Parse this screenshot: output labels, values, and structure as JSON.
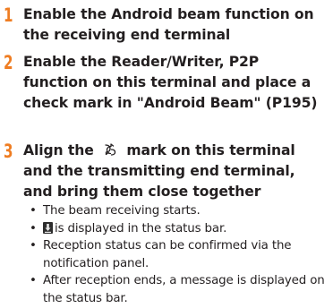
{
  "accent_color": "#ef7d22",
  "text_color": "#231f20",
  "steps": [
    {
      "number": "1",
      "text": "Enable the Android beam function on the receiving end terminal"
    },
    {
      "number": "2",
      "text": "Enable the Reader/Writer, P2P function on this terminal and place a check mark in \"Android Beam\" (P195)"
    },
    {
      "number": "3",
      "text_before": "Align the",
      "icon": "nfc-mark-icon",
      "text_after": "mark on this terminal and the transmitting end terminal, and bring them close together"
    }
  ],
  "bullets": [
    {
      "text": "The beam receiving starts."
    },
    {
      "icon": "download-status-icon",
      "text": "is displayed in the status bar."
    },
    {
      "text": "Reception status can be confirmed via the notification panel."
    },
    {
      "text": "After reception ends, a message is displayed on the status bar."
    }
  ],
  "bullet_glyph": "•"
}
